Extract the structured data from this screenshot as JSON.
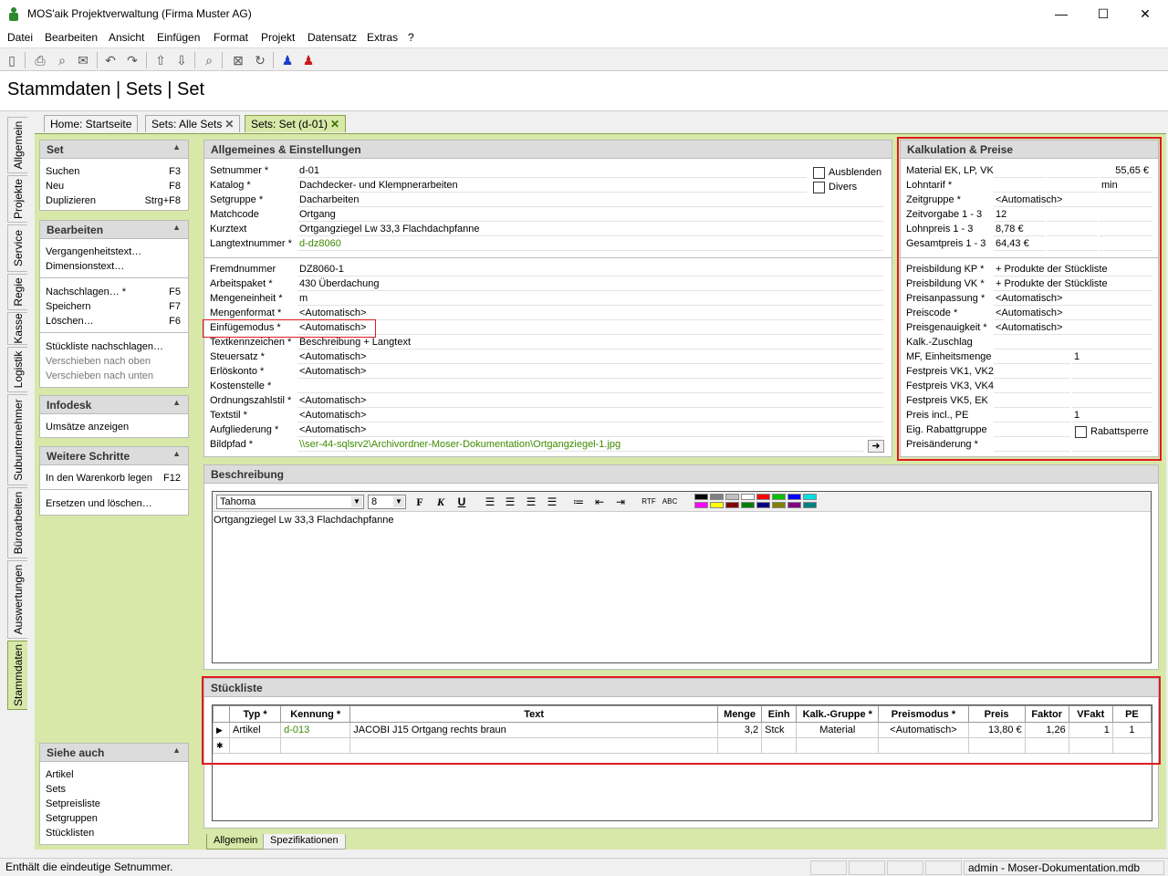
{
  "window": {
    "title": "MOS'aik Projektverwaltung (Firma Muster AG)",
    "minimize": "—",
    "maximize": "☐",
    "close": "✕"
  },
  "menu": [
    "Datei",
    "Bearbeiten",
    "Ansicht",
    "Einfügen",
    "Format",
    "Projekt",
    "Datensatz",
    "Extras",
    "?"
  ],
  "page_title": "Stammdaten  | Sets  | Set",
  "vtabs": [
    "Allgemein",
    "Projekte",
    "Service",
    "Regie",
    "Kasse",
    "Logistik",
    "Subunternehmer",
    "Büroarbeiten",
    "Auswertungen",
    "Stammdaten"
  ],
  "tabs": [
    {
      "label": "Home: Startseite"
    },
    {
      "label": "Sets: Alle Sets",
      "close": "✕"
    },
    {
      "label": "Sets: Set (d-01)",
      "close": "✕"
    }
  ],
  "sidebar": {
    "set": {
      "title": "Set",
      "items": [
        {
          "label": "Suchen",
          "key": "F3"
        },
        {
          "label": "Neu",
          "key": "F8"
        },
        {
          "label": "Duplizieren",
          "key": "Strg+F8"
        }
      ]
    },
    "bearbeiten": {
      "title": "Bearbeiten",
      "items1": [
        "Vergangenheitstext…",
        "Dimensionstext…"
      ],
      "items2": [
        {
          "label": "Nachschlagen… *",
          "key": "F5"
        },
        {
          "label": "Speichern",
          "key": "F7"
        },
        {
          "label": "Löschen…",
          "key": "F6"
        }
      ],
      "items3": [
        "Stückliste nachschlagen…",
        "Verschieben nach oben",
        "Verschieben nach unten"
      ]
    },
    "infodesk": {
      "title": "Infodesk",
      "items": [
        "Umsätze anzeigen"
      ]
    },
    "weitere": {
      "title": "Weitere Schritte",
      "items": [
        {
          "label": "In den Warenkorb legen",
          "key": "F12"
        },
        {
          "label": "Ersetzen und löschen…",
          "key": ""
        }
      ]
    },
    "siehe": {
      "title": "Siehe auch",
      "items": [
        "Artikel",
        "Sets",
        "Setpreisliste",
        "Setgruppen",
        "Stücklisten"
      ]
    }
  },
  "allgemein": {
    "title": "Allgemeines & Einstellungen",
    "fields1": [
      {
        "label": "Setnummer *",
        "value": "d-01"
      },
      {
        "label": "Katalog *",
        "value": "Dachdecker- und Klempnerarbeiten"
      },
      {
        "label": "Setgruppe *",
        "value": "Dacharbeiten"
      },
      {
        "label": "Matchcode",
        "value": "Ortgang"
      },
      {
        "label": "Kurztext",
        "value": "Ortgangziegel Lw 33,3 Flachdachpfanne"
      },
      {
        "label": "Langtextnummer *",
        "value": "d-dz8060"
      }
    ],
    "ausblenden": "Ausblenden",
    "divers": "Divers",
    "fields2": [
      {
        "label": "Fremdnummer",
        "value": "DZ8060-1"
      },
      {
        "label": "Arbeitspaket *",
        "value": "430 Überdachung"
      },
      {
        "label": "Mengeneinheit *",
        "value": "m"
      },
      {
        "label": "Mengenformat *",
        "value": "<Automatisch>"
      },
      {
        "label": "Einfügemodus *",
        "value": "<Automatisch>"
      },
      {
        "label": "Textkennzeichen *",
        "value": "Beschreibung + Langtext"
      },
      {
        "label": "Steuersatz *",
        "value": "<Automatisch>"
      },
      {
        "label": "Erlöskonto *",
        "value": "<Automatisch>"
      },
      {
        "label": "Kostenstelle *",
        "value": ""
      },
      {
        "label": "Ordnungszahlstil *",
        "value": "<Automatisch>"
      },
      {
        "label": "Textstil *",
        "value": "<Automatisch>"
      },
      {
        "label": "Aufgliederung *",
        "value": "<Automatisch>"
      },
      {
        "label": "Bildpfad *",
        "value": "\\\\ser-44-sqlsrv2\\Archivordner-Moser-Dokumentation\\Ortgangziegel-1.jpg"
      }
    ]
  },
  "kalk": {
    "title": "Kalkulation & Preise",
    "rows1": [
      {
        "label": "Material EK, LP, VK",
        "v1": "",
        "v2": "",
        "v3": "55,65 €"
      },
      {
        "label": "Lohntarif *",
        "v1": "",
        "v2": "",
        "v3": "min"
      },
      {
        "label": "Zeitgruppe *",
        "v1": "<Automatisch>",
        "v2": "",
        "v3": ""
      },
      {
        "label": "Zeitvorgabe 1 - 3",
        "v1": "12",
        "v2": "",
        "v3": ""
      },
      {
        "label": "Lohnpreis 1 - 3",
        "v1": "8,78 €",
        "v2": "",
        "v3": ""
      },
      {
        "label": "Gesamtpreis 1 - 3",
        "v1": "64,43 €",
        "v2": "",
        "v3": ""
      }
    ],
    "rows2": [
      {
        "label": "Preisbildung KP *",
        "v1": "+ Produkte der Stückliste"
      },
      {
        "label": "Preisbildung VK *",
        "v1": "+ Produkte der Stückliste"
      },
      {
        "label": "Preisanpassung *",
        "v1": "<Automatisch>"
      },
      {
        "label": "Preiscode *",
        "v1": "<Automatisch>"
      },
      {
        "label": "Preisgenauigkeit *",
        "v1": "<Automatisch>"
      },
      {
        "label": "Kalk.-Zuschlag",
        "v1": ""
      }
    ],
    "rows3": [
      {
        "label": "MF, Einheitsmenge",
        "v1": "",
        "v2": "1"
      },
      {
        "label": "Festpreis VK1, VK2",
        "v1": "",
        "v2": ""
      },
      {
        "label": "Festpreis VK3, VK4",
        "v1": "",
        "v2": ""
      },
      {
        "label": "Festpreis VK5, EK",
        "v1": "",
        "v2": ""
      },
      {
        "label": "Preis incl., PE",
        "v1": "",
        "v2": "1"
      },
      {
        "label": "Eig. Rabattgruppe",
        "v1": "",
        "v2": ""
      },
      {
        "label": "Preisänderung *",
        "v1": "",
        "v2": ""
      }
    ],
    "rabattsperre": "Rabattsperre"
  },
  "beschreibung": {
    "title": "Beschreibung",
    "font": "Tahoma",
    "size": "8",
    "text": "Ortgangziegel Lw 33,3 Flachdachpfanne",
    "toolbar": {
      "bold": "F",
      "italic": "K",
      "underline": "U"
    },
    "colors1": [
      "#000000",
      "#808080",
      "#c0c0c0",
      "#ffffff",
      "#ff0000",
      "#00c000",
      "#0000ff",
      "#00e0e0"
    ],
    "colors2": [
      "#ff00ff",
      "#ffff00",
      "#800000",
      "#008000",
      "#000080",
      "#808000",
      "#800080",
      "#008080"
    ]
  },
  "stueckliste": {
    "title": "Stückliste",
    "headers": [
      "Typ *",
      "Kennung *",
      "Text",
      "Menge",
      "Einh",
      "Kalk.-Gruppe *",
      "Preismodus *",
      "Preis",
      "Faktor",
      "VFakt",
      "PE"
    ],
    "rows": [
      [
        "Artikel",
        "d-013",
        "JACOBI J15 Ortgang rechts braun",
        "3,2",
        "Stck",
        "Material",
        "<Automatisch>",
        "13,80 €",
        "1,26",
        "1",
        "1"
      ]
    ]
  },
  "bottom_tabs": [
    "Allgemein",
    "Spezifikationen"
  ],
  "status": {
    "text": "Enthält die eindeutige Setnummer.",
    "user": "admin - Moser-Dokumentation.mdb"
  }
}
